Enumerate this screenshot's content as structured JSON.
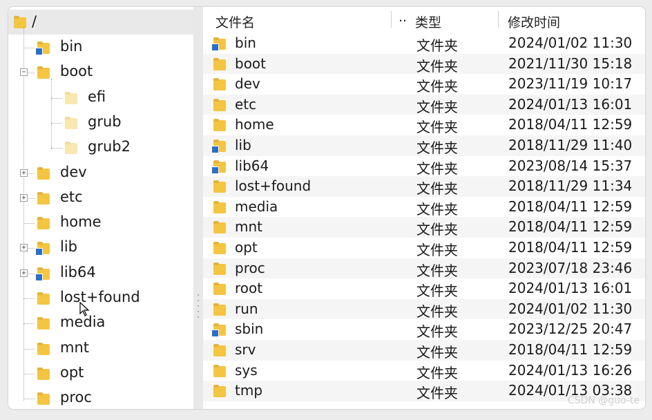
{
  "tree": {
    "root_label": "/",
    "items": [
      {
        "label": "bin",
        "link": true,
        "expander": ""
      },
      {
        "label": "boot",
        "link": false,
        "expander": "−"
      },
      {
        "label": "efi",
        "link": false,
        "expander": "",
        "child": true
      },
      {
        "label": "grub",
        "link": false,
        "expander": "",
        "child": true
      },
      {
        "label": "grub2",
        "link": false,
        "expander": "",
        "child": true
      },
      {
        "label": "dev",
        "link": false,
        "expander": "+"
      },
      {
        "label": "etc",
        "link": false,
        "expander": "+"
      },
      {
        "label": "home",
        "link": false,
        "expander": ""
      },
      {
        "label": "lib",
        "link": true,
        "expander": "+"
      },
      {
        "label": "lib64",
        "link": true,
        "expander": "+"
      },
      {
        "label": "lost+found",
        "link": false,
        "expander": ""
      },
      {
        "label": "media",
        "link": false,
        "expander": ""
      },
      {
        "label": "mnt",
        "link": false,
        "expander": ""
      },
      {
        "label": "opt",
        "link": false,
        "expander": ""
      },
      {
        "label": "proc",
        "link": false,
        "expander": ""
      }
    ]
  },
  "list": {
    "columns": {
      "name": "文件名",
      "name_more": "..",
      "type": "类型",
      "modified": "修改时间"
    },
    "rows": [
      {
        "name": "bin",
        "type": "文件夹",
        "modified": "2024/01/02 11:30",
        "link": true
      },
      {
        "name": "boot",
        "type": "文件夹",
        "modified": "2021/11/30 15:18",
        "link": false
      },
      {
        "name": "dev",
        "type": "文件夹",
        "modified": "2023/11/19 10:17",
        "link": false
      },
      {
        "name": "etc",
        "type": "文件夹",
        "modified": "2024/01/13 16:01",
        "link": false
      },
      {
        "name": "home",
        "type": "文件夹",
        "modified": "2018/04/11 12:59",
        "link": false
      },
      {
        "name": "lib",
        "type": "文件夹",
        "modified": "2018/11/29 11:40",
        "link": true
      },
      {
        "name": "lib64",
        "type": "文件夹",
        "modified": "2023/08/14 15:37",
        "link": true
      },
      {
        "name": "lost+found",
        "type": "文件夹",
        "modified": "2018/11/29 11:34",
        "link": false
      },
      {
        "name": "media",
        "type": "文件夹",
        "modified": "2018/04/11 12:59",
        "link": false
      },
      {
        "name": "mnt",
        "type": "文件夹",
        "modified": "2018/04/11 12:59",
        "link": false
      },
      {
        "name": "opt",
        "type": "文件夹",
        "modified": "2018/04/11 12:59",
        "link": false
      },
      {
        "name": "proc",
        "type": "文件夹",
        "modified": "2023/07/18 23:46",
        "link": false
      },
      {
        "name": "root",
        "type": "文件夹",
        "modified": "2024/01/13 16:01",
        "link": false
      },
      {
        "name": "run",
        "type": "文件夹",
        "modified": "2024/01/02 11:30",
        "link": false
      },
      {
        "name": "sbin",
        "type": "文件夹",
        "modified": "2023/12/25 20:47",
        "link": true
      },
      {
        "name": "srv",
        "type": "文件夹",
        "modified": "2018/04/11 12:59",
        "link": false
      },
      {
        "name": "sys",
        "type": "文件夹",
        "modified": "2024/01/13 16:26",
        "link": false
      },
      {
        "name": "tmp",
        "type": "文件夹",
        "modified": "2024/01/13 03:38",
        "link": false
      }
    ]
  },
  "watermark": "CSDN @guo-te",
  "colors": {
    "folder": "#f4c542",
    "link_badge": "#2a6fc9",
    "selection": "#e9e9e9"
  }
}
